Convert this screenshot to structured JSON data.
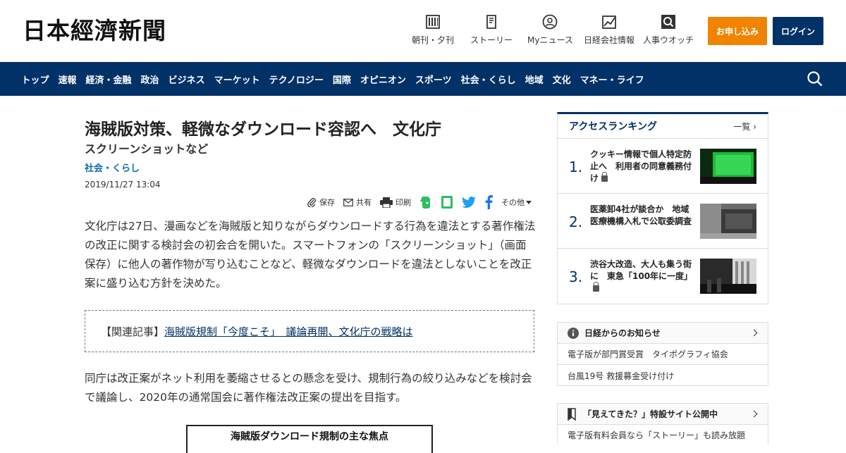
{
  "header": {
    "logo": "日本經濟新聞",
    "nav": [
      {
        "label": "朝刊・夕刊",
        "icon": "newspaper-icon"
      },
      {
        "label": "ストーリー",
        "icon": "story-icon"
      },
      {
        "label": "Myニュース",
        "icon": "user-icon"
      },
      {
        "label": "日経会社情報",
        "icon": "chart-icon"
      },
      {
        "label": "人事ウオッチ",
        "icon": "search-person-icon"
      }
    ],
    "subscribe": "お申し込み",
    "login": "ログイン"
  },
  "navbar": {
    "items": [
      "トップ",
      "速報",
      "経済・金融",
      "政治",
      "ビジネス",
      "マーケット",
      "テクノロジー",
      "国際",
      "オピニオン",
      "スポーツ",
      "社会・くらし",
      "地域",
      "文化",
      "マネー・ライフ"
    ]
  },
  "article": {
    "title": "海賊版対策、軽微なダウンロード容認へ　文化庁",
    "subtitle": "スクリーンショットなど",
    "category": "社会・くらし",
    "date": "2019/11/27 13:04",
    "tools": {
      "save": "保存",
      "share": "共有",
      "print": "印刷",
      "more": "その他"
    },
    "paragraph1": "文化庁は27日、漫画などを海賊版と知りながらダウンロードする行為を違法とする著作権法の改正に関する検討会の初会合を開いた。スマートフォンの「スクリーンショット」（画面保存）に他人の著作物が写り込むことなど、軽微なダウンロードを違法としないことを改正案に盛り込む方針を決めた。",
    "related_label": "【関連記事】",
    "related_link": "海賊版規制「今度こそ」　議論再開、文化庁の戦略は",
    "paragraph2": "同庁は改正案がネット利用を萎縮させるとの懸念を受け、規制行為の絞り込みなどを検討会で議論し、2020年の通常国会に著作権法改正案の提出を目指す。",
    "figure_title": "海賊版ダウンロード規制の主な焦点"
  },
  "ranking": {
    "title": "アクセスランキング",
    "more": "一覧",
    "items": [
      {
        "num": "1.",
        "text": "クッキー情報で個人特定防止へ　利用者の同意義務付け"
      },
      {
        "num": "2.",
        "text": "医薬卸4社が談合か　地域医療機構入札で公取委調査"
      },
      {
        "num": "3.",
        "text": "渋谷大改造、大人も集う街に　東急「100年に一度」"
      }
    ]
  },
  "notice": {
    "title": "日経からのお知らせ",
    "items": [
      "電子版が部門賞受賞　タイポグラフィ協会",
      "台風19号 救援募金受け付け"
    ]
  },
  "special": {
    "title": "「見えてきた？」特設サイト公開中",
    "items": [
      "電子版有料会員なら「ストーリー」も読み放題"
    ]
  },
  "colors": {
    "brand": "#003167",
    "accent": "#f08300",
    "link": "#0a6bb0"
  }
}
